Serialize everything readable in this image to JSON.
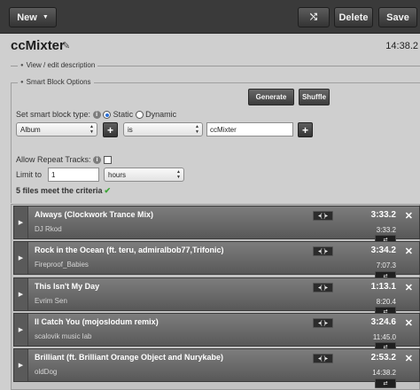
{
  "toolbar": {
    "new_label": "New",
    "delete_label": "Delete",
    "save_label": "Save",
    "shuffle_icon": "shuffle-icon"
  },
  "block": {
    "title": "ccMixter",
    "length": "14:38.2"
  },
  "view_edit_label": "View / edit description",
  "smart_block": {
    "legend": "Smart Block Options",
    "generate_label": "Generate",
    "shuffle_label": "Shuffle",
    "set_type_label": "Set smart block type:",
    "type_static": "Static",
    "type_dynamic": "Dynamic",
    "criteria_field": "Album",
    "criteria_modifier": "is",
    "criteria_value": "ccMixter",
    "allow_repeat_label": "Allow Repeat Tracks:",
    "limit_label": "Limit to",
    "limit_value": "1",
    "limit_unit": "hours",
    "match_text": "5 files meet the criteria"
  },
  "tracks": [
    {
      "title": "Always (Clockwork Trance Mix)",
      "artist": "DJ Rkod",
      "length": "3:33.2",
      "running": "3:33.2"
    },
    {
      "title": "Rock in the Ocean (ft. teru, admiralbob77,Trifonic)",
      "artist": "Fireproof_Babies",
      "length": "3:34.2",
      "running": "7:07.3"
    },
    {
      "title": "This Isn't My Day",
      "artist": "Evrim Sen",
      "length": "1:13.1",
      "running": "8:20.4"
    },
    {
      "title": "Il Catch You (mojoslodum remix)",
      "artist": "scalovik music lab",
      "length": "3:24.6",
      "running": "11:45.0"
    },
    {
      "title": "Brilliant (ft. Brilliant Orange Object and Nurykabe)",
      "artist": "oldDog",
      "length": "2:53.2",
      "running": "14:38.2"
    }
  ],
  "colors": {
    "toolbar_bg": "#3a3a3a",
    "page_bg": "#cfcfcf",
    "track_bg": "#6b6b6b",
    "check_green": "#3aa435"
  }
}
